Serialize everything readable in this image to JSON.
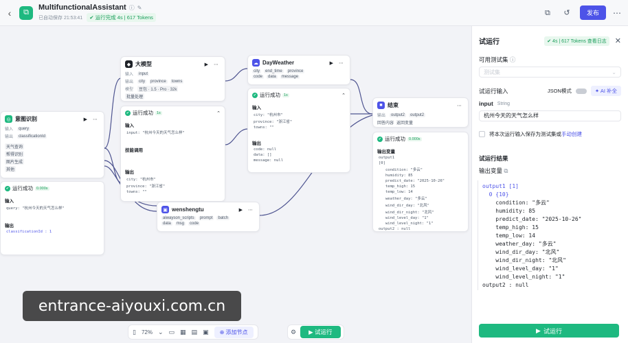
{
  "header": {
    "app_title": "MultifunctionalAssistant",
    "saved": "已自动保存 21:53:41",
    "run_status": "运行完成 4s | 617 Tokens",
    "publish": "发布"
  },
  "nodes": {
    "intent": {
      "title": "意图识别",
      "in_label": "输入",
      "in_tag": "query",
      "out_label": "输出",
      "out_tag": "classificationId",
      "options": [
        "天气查询",
        "帮得识别",
        "图片生成",
        "其他"
      ],
      "run": "运行成功",
      "dur": "0.000s",
      "input_h": "输入",
      "input_val": "query: \"杭州今天的天气怎么样\"",
      "output_h": "输出",
      "output_val": "classificationId : 1"
    },
    "llm": {
      "title": "大模型",
      "in_label": "输入",
      "in_tag": "input",
      "out_label": "输出",
      "out_tags": [
        "city",
        "province",
        "towns"
      ],
      "model_label": "模型",
      "model": "豆包 · 1.5 · Pro · 32k",
      "batch": "批量处理",
      "run": "运行成功",
      "dur": "1s",
      "input_h": "输入",
      "input_val": "input: \"杭州今天的天气怎么样\"",
      "skill_h": "技能调用",
      "output_h": "输出",
      "out_lines": [
        "city: \"杭州市\"",
        "province: \"浙江省\"",
        "towns: \"\""
      ]
    },
    "weather": {
      "title": "DayWeather",
      "in_tags": [
        "city",
        "end_time",
        "province"
      ],
      "out_tags": [
        "code",
        "data",
        "message"
      ],
      "run": "运行成功",
      "dur": "1s",
      "input_h": "输入",
      "in_lines": [
        "city: \"杭州市\"",
        "province: \"浙江省\"",
        "towns: \"\""
      ],
      "output_h": "输出",
      "out_lines": [
        "code: null",
        "data: []",
        "message: null"
      ]
    },
    "sheng": {
      "title": "wenshengtu",
      "in_tags": [
        "aiwayson_scripts",
        "prompt",
        "batch"
      ],
      "out_tags": [
        "data",
        "msg",
        "code"
      ]
    },
    "end": {
      "title": "结束",
      "out_label": "输出",
      "out_tags": [
        "output2",
        "output2"
      ],
      "ret_label": "回答内容",
      "ret": "返回变量",
      "run": "运行成功",
      "dur": "0.000s",
      "output_h": "输出变量",
      "lines": [
        "output1",
        "[0]",
        "condition: \"多云\"",
        "humidity: 85",
        "predict_date: \"2025-10-26\"",
        "temp_high: 15",
        "temp_low: 14",
        "weather_day: \"多云\"",
        "wind_dir_day: \"北风\"",
        "wind_dir_night: \"北风\"",
        "wind_level_day: \"1\"",
        "wind_level_night: \"1\"",
        "output2 : null"
      ]
    }
  },
  "toolbar": {
    "zoom": "72%",
    "add_node": "添加节点",
    "try_run": "试运行"
  },
  "panel": {
    "title": "试运行",
    "badge": "4s | 617 Tokens  查看日志",
    "dataset_label": "可用测试集",
    "dataset_placeholder": "测试集",
    "input_label": "试运行输入",
    "json_mode": "JSON模式",
    "ai_fill": "AI 补全",
    "input_name": "input",
    "input_type": "String",
    "input_value": "杭州今天的天气怎么样",
    "save_text": "将本次运行输入保存为测试集或",
    "save_link": "手动创建",
    "result_label": "试运行结果",
    "output_var": "输出变量",
    "output": [
      "output1 [1]",
      "  0 {10}",
      "    condition: \"多云\"",
      "    humidity: 85",
      "    predict_date: \"2025-10-26\"",
      "    temp_high: 15",
      "    temp_low: 14",
      "    weather_day: \"多云\"",
      "    wind_dir_day: \"北风\"",
      "    wind_dir_night: \"北风\"",
      "    wind_level_day: \"1\"",
      "    wind_level_night: \"1\"",
      "output2 : null"
    ],
    "run_button": "试运行"
  },
  "watermark": "entrance-aiyouxi.com.cn",
  "colors": {
    "accent": "#4d53e8",
    "success": "#1eb980"
  }
}
